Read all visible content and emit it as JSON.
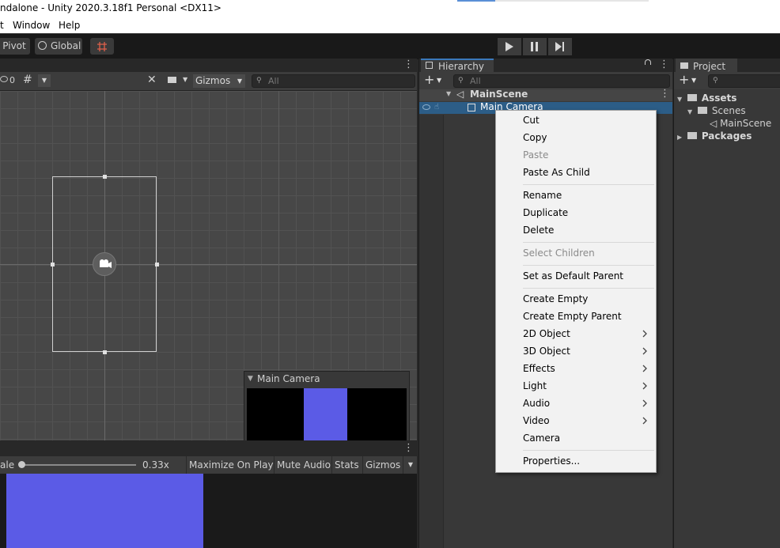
{
  "window": {
    "title": "ndalone - Unity 2020.3.18f1 Personal <DX11>"
  },
  "menubar": {
    "items": [
      "t",
      "Window",
      "Help"
    ]
  },
  "toolbar": {
    "pivot_label": "Pivot",
    "global_label": "Global"
  },
  "scene": {
    "visibility_count": "0",
    "gizmos_label": "Gizmos",
    "search_placeholder": "All",
    "preview_title": "Main Camera"
  },
  "game": {
    "scale_label": "ale",
    "scale_value": "0.33x",
    "maximize_label": "Maximize On Play",
    "mute_label": "Mute Audio",
    "stats_label": "Stats",
    "gizmos_label": "Gizmos"
  },
  "hierarchy": {
    "tab_label": "Hierarchy",
    "search_placeholder": "All",
    "scene_name": "MainScene",
    "selected_item": "Main Camera"
  },
  "project": {
    "tab_label": "Project",
    "tree": {
      "assets": "Assets",
      "scenes": "Scenes",
      "main_scene": "MainScene",
      "packages": "Packages"
    }
  },
  "context_menu": {
    "items": {
      "cut": "Cut",
      "copy": "Copy",
      "paste": "Paste",
      "paste_as_child": "Paste As Child",
      "rename": "Rename",
      "duplicate": "Duplicate",
      "delete": "Delete",
      "select_children": "Select Children",
      "set_default_parent": "Set as Default Parent",
      "create_empty": "Create Empty",
      "create_empty_parent": "Create Empty Parent",
      "object_2d": "2D Object",
      "object_3d": "3D Object",
      "effects": "Effects",
      "light": "Light",
      "audio": "Audio",
      "video": "Video",
      "camera": "Camera",
      "properties": "Properties..."
    }
  },
  "colors": {
    "game_view": "#5b5be6",
    "selection": "#2c5d87",
    "accent": "#3a79bb"
  }
}
